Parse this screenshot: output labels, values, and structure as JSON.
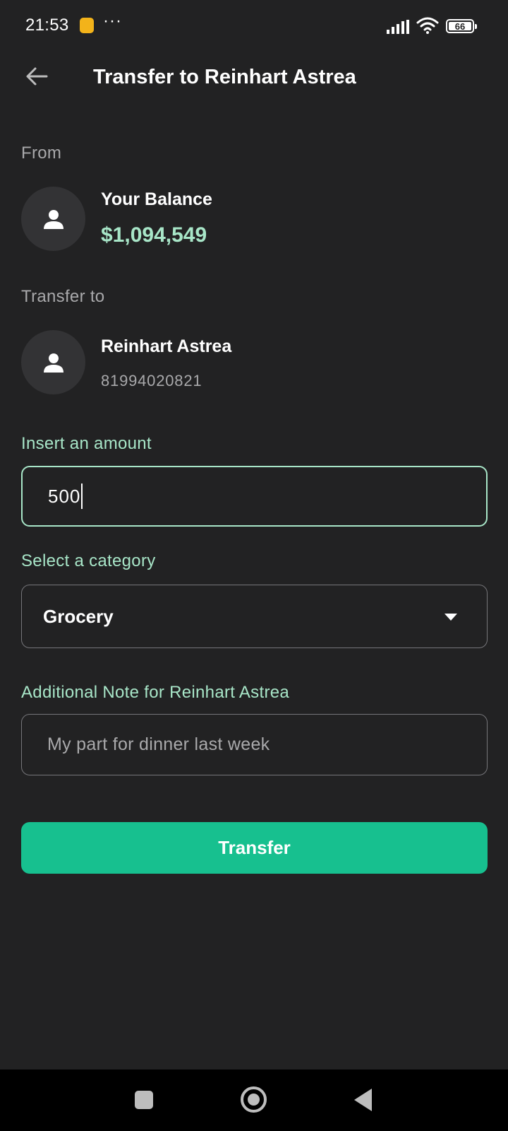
{
  "status_bar": {
    "time": "21:53",
    "dots": "···",
    "battery": "66"
  },
  "header": {
    "title": "Transfer to Reinhart Astrea",
    "back_icon": "arrow-left-icon"
  },
  "from": {
    "label": "From",
    "name": "Your Balance",
    "balance": "$1,094,549",
    "avatar_icon": "person-icon"
  },
  "to": {
    "label": "Transfer to",
    "name": "Reinhart Astrea",
    "account_number": "81994020821",
    "avatar_icon": "person-icon"
  },
  "amount": {
    "label": "Insert an amount",
    "value": "500"
  },
  "category": {
    "label": "Select a category",
    "selected": "Grocery"
  },
  "note": {
    "label": "Additional Note for Reinhart Astrea",
    "placeholder": "My part for dinner last week"
  },
  "actions": {
    "transfer_label": "Transfer"
  },
  "colors": {
    "background": "#222223",
    "accent": "#a8e6c8",
    "button": "#17c08f",
    "muted_text": "#a9a9ab"
  }
}
